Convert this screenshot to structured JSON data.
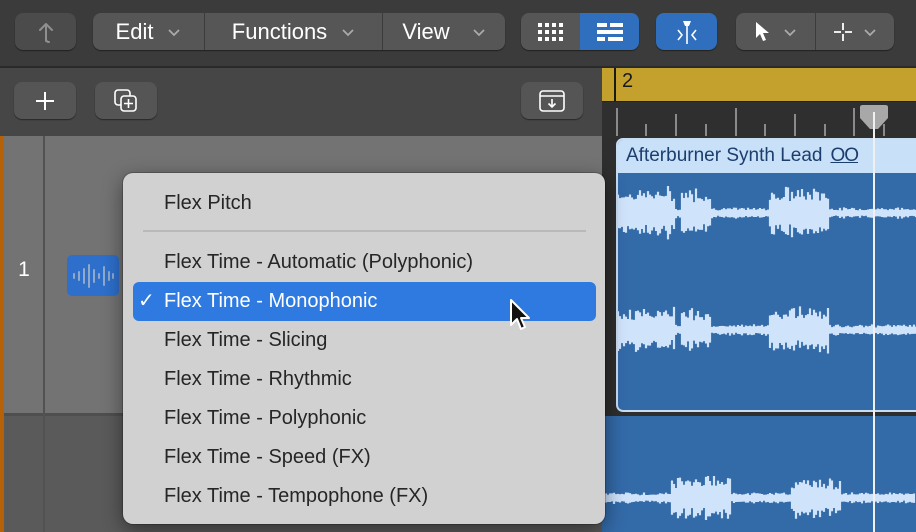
{
  "toolbar": {
    "back_icon": "catch-up-arrow-icon",
    "menus": [
      {
        "label": "Edit"
      },
      {
        "label": "Functions"
      },
      {
        "label": "View"
      }
    ],
    "view_toggle": {
      "grid_icon": "grid-view-icon",
      "list_icon": "list-view-icon",
      "active": "list"
    },
    "flex_button": {
      "icon": "flex-tool-icon",
      "active": true
    },
    "tools": [
      {
        "icon": "pointer-tool-icon"
      },
      {
        "icon": "marquee-tool-icon"
      }
    ]
  },
  "subbar": {
    "add_track_icon": "plus-icon",
    "duplicate_track_icon": "duplicate-track-icon",
    "download_icon": "inbox-download-icon"
  },
  "ruler": {
    "bar_number": "2"
  },
  "tracks": [
    {
      "number": "1",
      "icon": "audio-waveform-icon"
    }
  ],
  "region": {
    "name": "Afterburner Synth Lead",
    "loop_symbol": "OO"
  },
  "flex_menu": {
    "items": [
      {
        "label": "Flex Pitch",
        "checked": false,
        "selected": false
      },
      {
        "separator": true
      },
      {
        "label": "Flex Time - Automatic (Polyphonic)",
        "checked": false,
        "selected": false
      },
      {
        "label": "Flex Time - Monophonic",
        "checked": true,
        "selected": true
      },
      {
        "label": "Flex Time - Slicing",
        "checked": false,
        "selected": false
      },
      {
        "label": "Flex Time - Rhythmic",
        "checked": false,
        "selected": false
      },
      {
        "label": "Flex Time - Polyphonic",
        "checked": false,
        "selected": false
      },
      {
        "label": "Flex Time - Speed (FX)",
        "checked": false,
        "selected": false
      },
      {
        "label": "Flex Time - Tempophone (FX)",
        "checked": false,
        "selected": false
      }
    ],
    "check_glyph": "✓"
  },
  "colors": {
    "accent_blue": "#2e7ae0",
    "region_blue": "#336aa8",
    "ruler_gold": "#c4a02c",
    "track_orange": "#b5610a"
  }
}
